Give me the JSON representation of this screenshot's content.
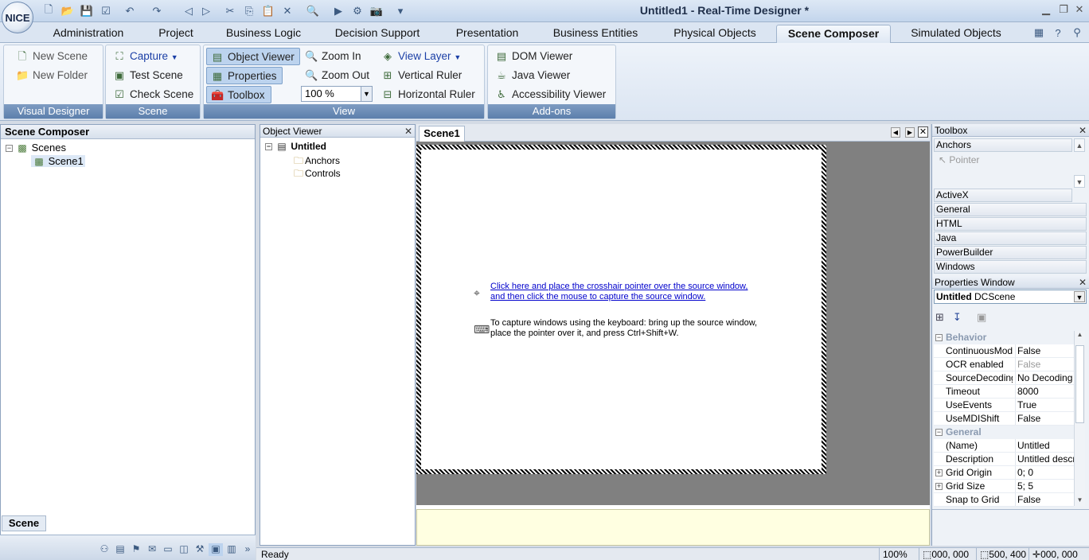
{
  "app": {
    "logo": "NICE",
    "title": "Untitled1 - Real-Time Designer *"
  },
  "ribbon_tabs": [
    "Administration",
    "Project",
    "Business Logic",
    "Decision Support",
    "Presentation",
    "Business Entities",
    "Physical Objects",
    "Scene Composer",
    "Simulated Objects"
  ],
  "active_tab": "Scene Composer",
  "ribbon": {
    "visual_designer": {
      "label": "Visual Designer",
      "new_scene": "New Scene",
      "new_folder": "New Folder"
    },
    "scene": {
      "label": "Scene",
      "capture": "Capture",
      "test_scene": "Test Scene",
      "check_scene": "Check Scene"
    },
    "view": {
      "label": "View",
      "object_viewer": "Object Viewer",
      "properties": "Properties",
      "toolbox": "Toolbox",
      "zoom_in": "Zoom In",
      "zoom_out": "Zoom Out",
      "zoom_value": "100 %",
      "view_layer": "View Layer",
      "vertical_ruler": "Vertical Ruler",
      "horizontal_ruler": "Horizontal Ruler"
    },
    "addons": {
      "label": "Add-ons",
      "dom_viewer": "DOM Viewer",
      "java_viewer": "Java Viewer",
      "accessibility_viewer": "Accessibility Viewer"
    }
  },
  "left_panel": {
    "title": "Scene Composer",
    "tree_root": "Scenes",
    "tree_child": "Scene1",
    "bottom_tab": "Scene"
  },
  "object_viewer": {
    "title": "Object Viewer",
    "root": "Untitled",
    "children": [
      "Anchors",
      "Controls"
    ]
  },
  "scene_tab": "Scene1",
  "capture": {
    "link_line1": "Click here and place the crosshair pointer over the source window,",
    "link_line2": "and then click the mouse to capture the source window.",
    "kb_line1": "To capture windows using the keyboard: bring up the source window,",
    "kb_line2": "place the pointer over it, and press Ctrl+Shift+W."
  },
  "toolbox": {
    "title": "Toolbox",
    "section": "Anchors",
    "pointer": "Pointer",
    "sections": [
      "ActiveX",
      "General",
      "HTML",
      "Java",
      "PowerBuilder",
      "Windows"
    ]
  },
  "properties": {
    "title": "Properties Window",
    "object_name": "Untitled",
    "object_type": "DCScene",
    "categories": [
      {
        "name": "Behavior",
        "rows": [
          {
            "name": "ContinuousMode",
            "value": "False"
          },
          {
            "name": "OCR enabled",
            "value": "False"
          },
          {
            "name": "SourceDecoding",
            "value": "No Decoding"
          },
          {
            "name": "Timeout",
            "value": "8000"
          },
          {
            "name": "UseEvents",
            "value": "True"
          },
          {
            "name": "UseMDIShift",
            "value": "False"
          }
        ]
      },
      {
        "name": "General",
        "rows": [
          {
            "name": "(Name)",
            "value": "Untitled"
          },
          {
            "name": "Description",
            "value": "Untitled description"
          },
          {
            "name": "Grid Origin",
            "value": "0; 0"
          },
          {
            "name": "Grid Size",
            "value": "5; 5"
          },
          {
            "name": "Snap to Grid",
            "value": "False"
          }
        ]
      }
    ]
  },
  "status": {
    "text": "Ready",
    "zoom": "100%",
    "position": "000, 000",
    "size": "500, 400",
    "cursor": "000, 000"
  }
}
